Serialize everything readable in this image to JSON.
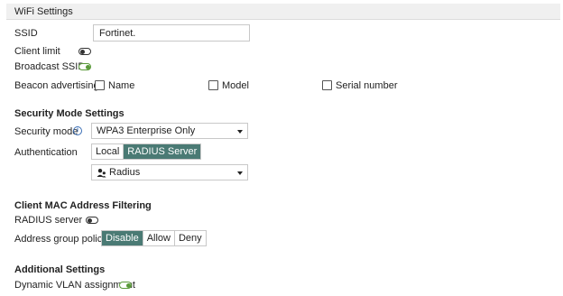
{
  "header": {
    "title": "WiFi Settings"
  },
  "wifi": {
    "ssid_label": "SSID",
    "ssid_value": "Fortinet.",
    "client_limit_label": "Client limit",
    "client_limit_on": false,
    "broadcast_ssid_label": "Broadcast SSID",
    "broadcast_ssid_on": true,
    "beacon_label": "Beacon advertising",
    "beacon_options": [
      {
        "label": "Name",
        "checked": false
      },
      {
        "label": "Model",
        "checked": false
      },
      {
        "label": "Serial number",
        "checked": false
      }
    ]
  },
  "security": {
    "title": "Security Mode Settings",
    "mode_label": "Security mode",
    "mode_value": "WPA3 Enterprise Only",
    "auth_label": "Authentication",
    "auth_options": [
      "Local",
      "RADIUS Server"
    ],
    "auth_selected": "RADIUS Server",
    "radius_value": "Radius"
  },
  "mac_filter": {
    "title": "Client MAC Address Filtering",
    "radius_server_label": "RADIUS server",
    "radius_server_on": false,
    "policy_label": "Address group policy",
    "policy_options": [
      "Disable",
      "Allow",
      "Deny"
    ],
    "policy_selected": "Disable"
  },
  "additional": {
    "title": "Additional Settings",
    "dynamic_vlan_label": "Dynamic VLAN assignment",
    "dynamic_vlan_on": true
  },
  "colors": {
    "accent": "#4a7a74",
    "toggle_on": "#5a9a3a"
  }
}
